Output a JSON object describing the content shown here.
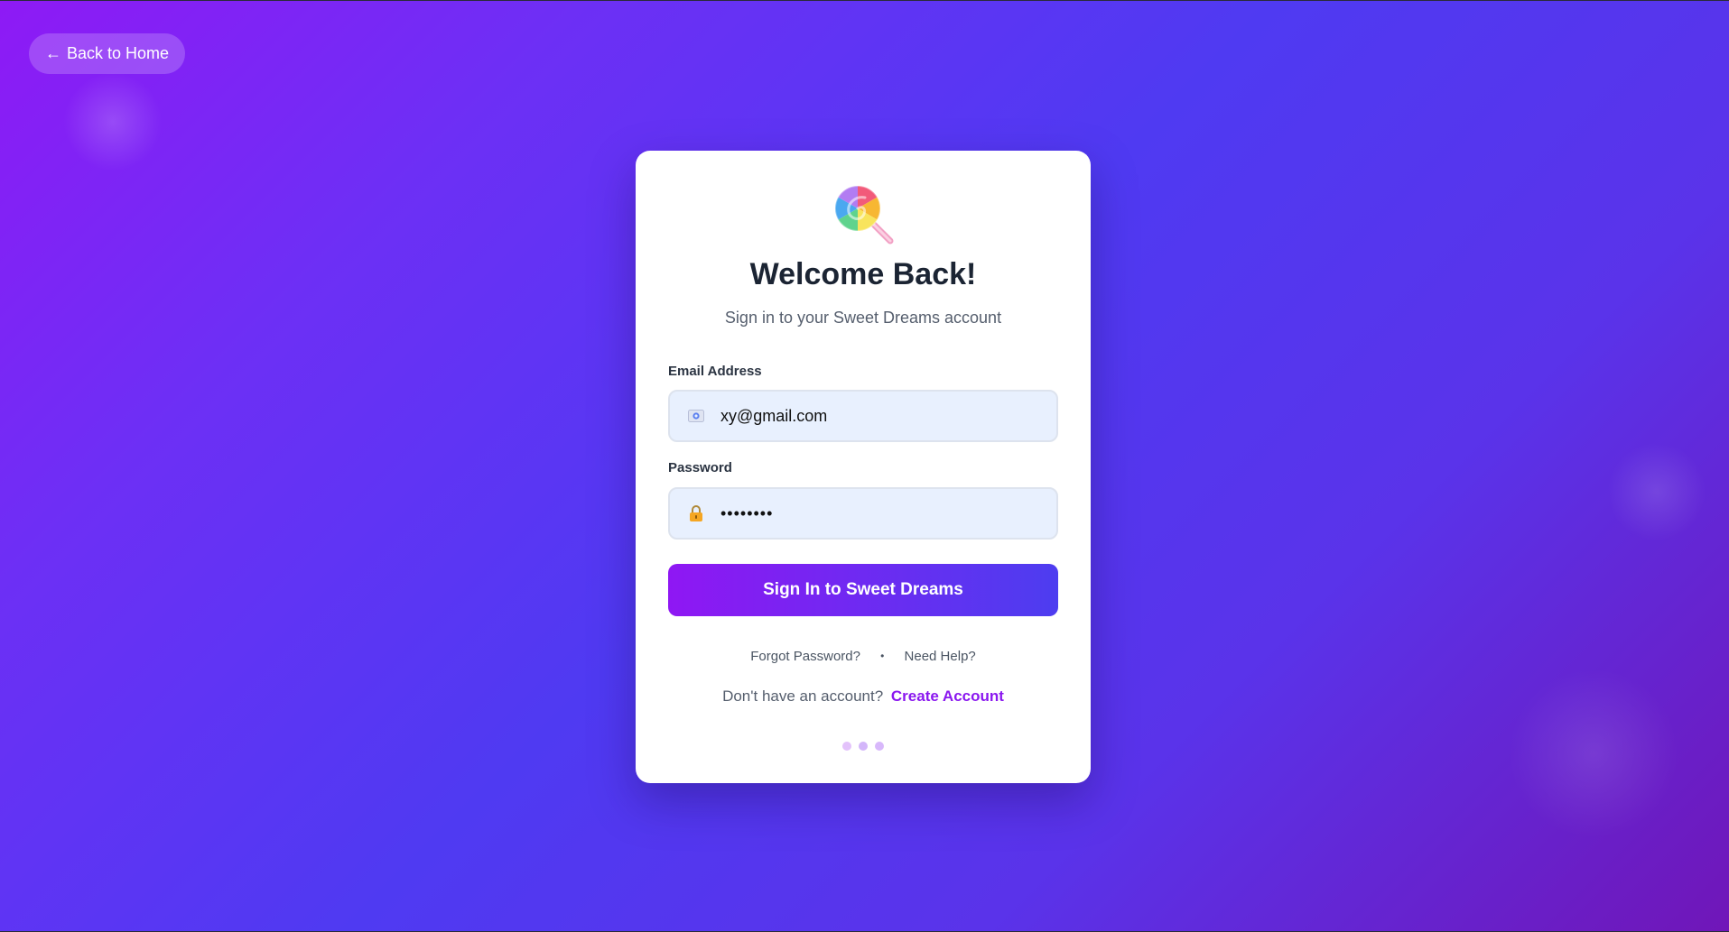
{
  "nav": {
    "back_arrow": "←",
    "back_label": "Back to Home"
  },
  "card": {
    "logo_icon": "lollipop-icon",
    "title": "Welcome Back!",
    "subtitle": "Sign in to your Sweet Dreams account"
  },
  "form": {
    "email_label": "Email Address",
    "email_icon": "envelope-icon",
    "email_value": "xy@gmail.com",
    "password_label": "Password",
    "password_icon": "lock-icon",
    "password_value": "••••••••",
    "submit_label": "Sign In to Sweet Dreams"
  },
  "links": {
    "forgot": "Forgot Password?",
    "separator": "•",
    "help": "Need Help?"
  },
  "signup": {
    "prompt": "Don't have an account?",
    "link": "Create Account"
  },
  "colors": {
    "accent": "#8a17ef",
    "gradient_start": "#8f17f3",
    "gradient_end": "#4d3df0",
    "dot_colors": [
      "#e3c2fb",
      "#d3b6fa",
      "#d8b8fb"
    ]
  }
}
